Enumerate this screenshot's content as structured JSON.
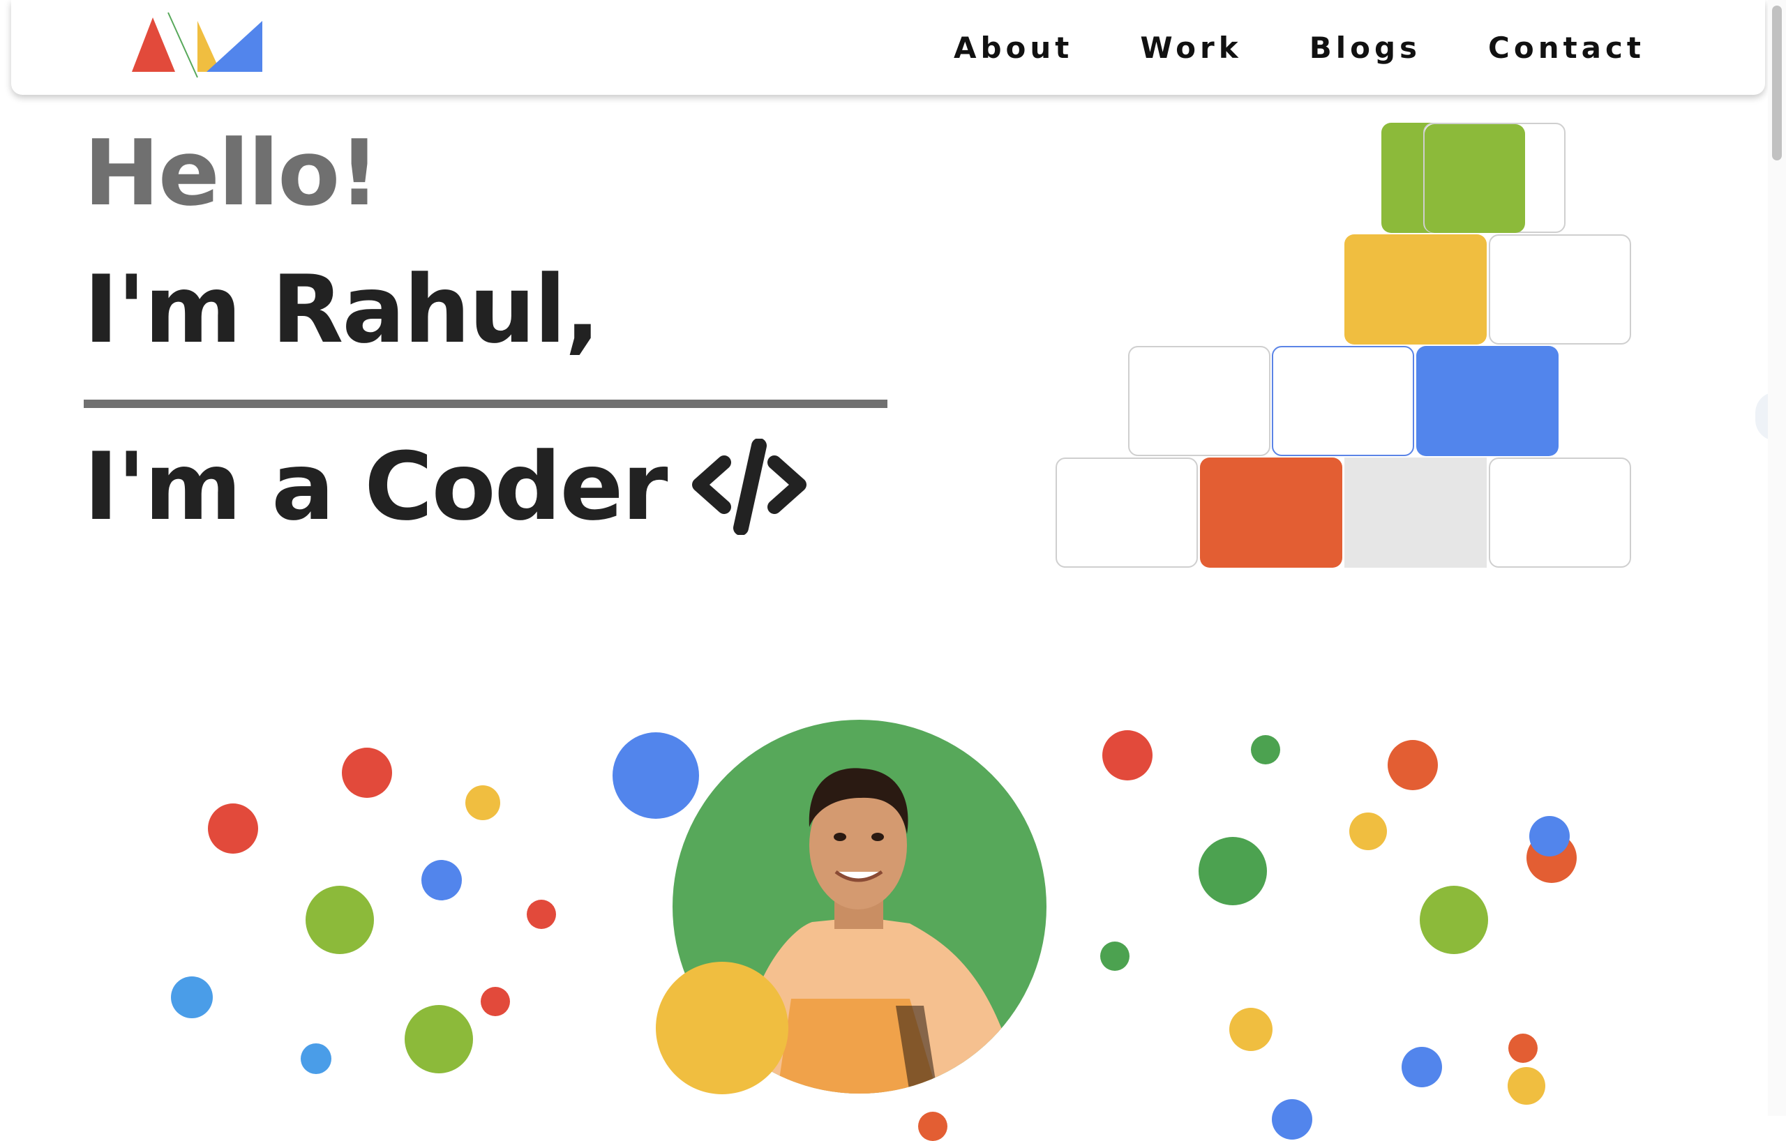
{
  "nav": {
    "links": [
      {
        "label": "About"
      },
      {
        "label": "Work"
      },
      {
        "label": "Blogs"
      },
      {
        "label": "Contact"
      }
    ]
  },
  "hero": {
    "greeting": "Hello!",
    "name_line": "I'm Rahul,",
    "role_line": "I'm a Coder"
  },
  "colors": {
    "red": "#e24a3b",
    "yellow": "#f0be40",
    "blue": "#5285ec",
    "green": "#8cba3a",
    "dark_green": "#57a85a",
    "text_dark": "#222222",
    "text_gray": "#707070"
  },
  "icons": [
    "logo-mark",
    "code-icon"
  ]
}
